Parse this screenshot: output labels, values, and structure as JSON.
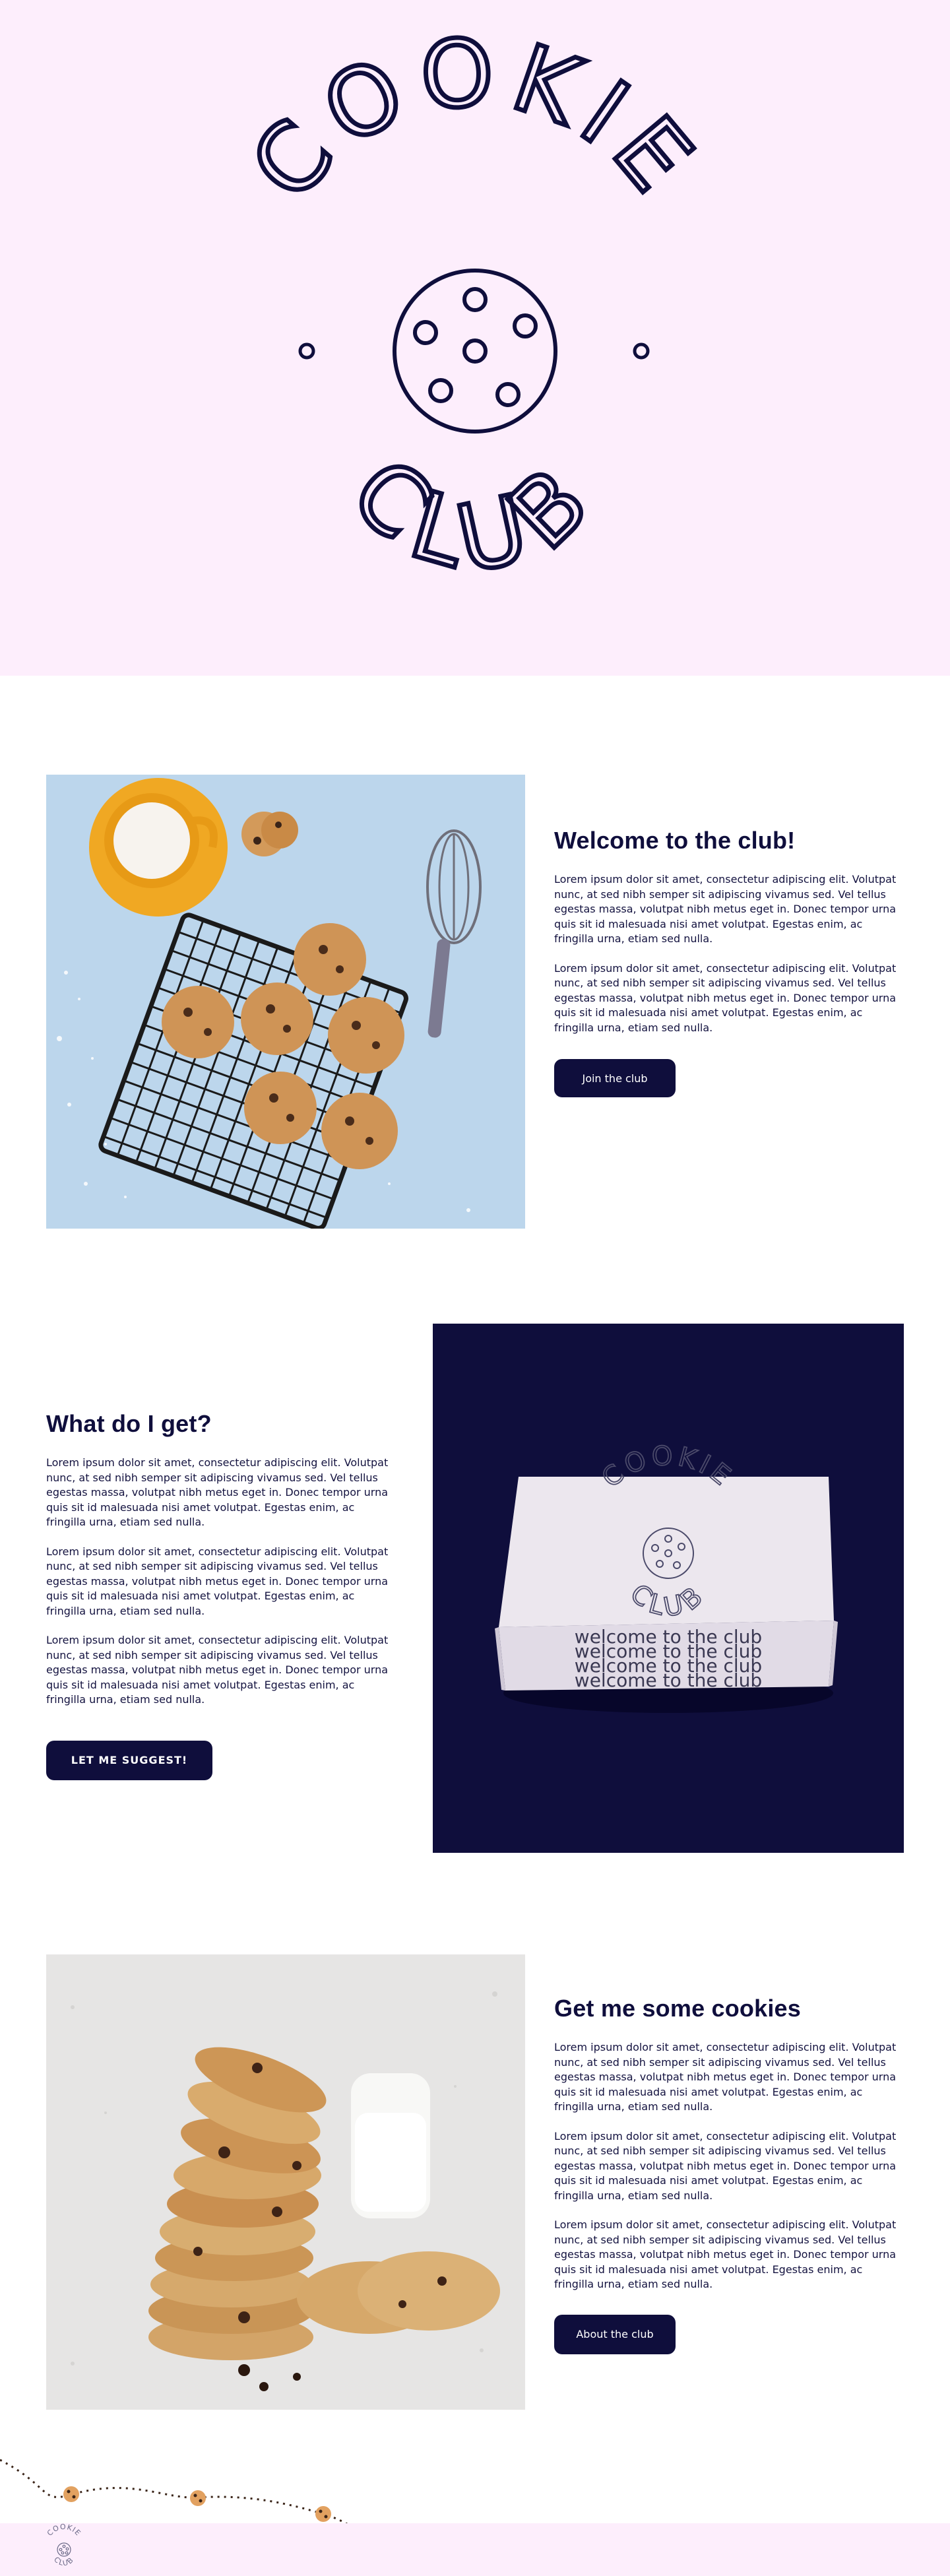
{
  "hero": {
    "logo_top_text": "COOKIE",
    "logo_bottom_text": "CLUB"
  },
  "sections": [
    {
      "heading": "Welcome to the club!",
      "paragraphs": [
        "Lorem ipsum dolor sit amet, consectetur adipiscing elit. Volutpat nunc, at sed nibh semper sit adipiscing vivamus sed. Vel tellus egestas massa, volutpat nibh metus eget in. Donec tempor urna quis sit id malesuada nisi amet volutpat. Egestas enim, ac fringilla urna, etiam sed nulla.",
        "Lorem ipsum dolor sit amet, consectetur adipiscing elit. Volutpat nunc, at sed nibh semper sit adipiscing vivamus sed. Vel tellus egestas massa, volutpat nibh metus eget in. Donec tempor urna quis sit id malesuada nisi amet volutpat. Egestas enim, ac fringilla urna, etiam sed nulla."
      ],
      "button": "Join the club"
    },
    {
      "heading": "What do I get?",
      "paragraphs": [
        "Lorem ipsum dolor sit amet, consectetur adipiscing elit. Volutpat nunc, at sed nibh semper sit adipiscing vivamus sed. Vel tellus egestas massa, volutpat nibh metus eget in. Donec tempor urna quis sit id malesuada nisi amet volutpat. Egestas enim, ac fringilla urna, etiam sed nulla.",
        "Lorem ipsum dolor sit amet, consectetur adipiscing elit. Volutpat nunc, at sed nibh semper sit adipiscing vivamus sed. Vel tellus egestas massa, volutpat nibh metus eget in. Donec tempor urna quis sit id malesuada nisi amet volutpat. Egestas enim, ac fringilla urna, etiam sed nulla.",
        "Lorem ipsum dolor sit amet, consectetur adipiscing elit. Volutpat nunc, at sed nibh semper sit adipiscing vivamus sed. Vel tellus egestas massa, volutpat nibh metus eget in. Donec tempor urna quis sit id malesuada nisi amet volutpat. Egestas enim, ac fringilla urna, etiam sed nulla."
      ],
      "button": "LET ME SUGGEST!",
      "box_logo_top": "COOKIE",
      "box_logo_bottom": "CLUB",
      "box_tagline": "welcome to the club"
    },
    {
      "heading": "Get me some cookies",
      "paragraphs": [
        "Lorem ipsum dolor sit amet, consectetur adipiscing elit. Volutpat nunc, at sed nibh semper sit adipiscing vivamus sed. Vel tellus egestas massa, volutpat nibh metus eget in. Donec tempor urna quis sit id malesuada nisi amet volutpat. Egestas enim, ac fringilla urna, etiam sed nulla.",
        "Lorem ipsum dolor sit amet, consectetur adipiscing elit. Volutpat nunc, at sed nibh semper sit adipiscing vivamus sed. Vel tellus egestas massa, volutpat nibh metus eget in. Donec tempor urna quis sit id malesuada nisi amet volutpat. Egestas enim, ac fringilla urna, etiam sed nulla.",
        "Lorem ipsum dolor sit amet, consectetur adipiscing elit. Volutpat nunc, at sed nibh semper sit adipiscing vivamus sed. Vel tellus egestas massa, volutpat nibh metus eget in. Donec tempor urna quis sit id malesuada nisi amet volutpat. Egestas enim, ac fringilla urna, etiam sed nulla."
      ],
      "button": "About the club"
    }
  ],
  "footer": {
    "logo_top_text": "COOKIE",
    "logo_bottom_text": "CLUB"
  },
  "colors": {
    "navy": "#0f0e3c",
    "pink": "#fdeefc",
    "photo_blue": "#b9d4ea",
    "cookie": "#c98a46"
  }
}
